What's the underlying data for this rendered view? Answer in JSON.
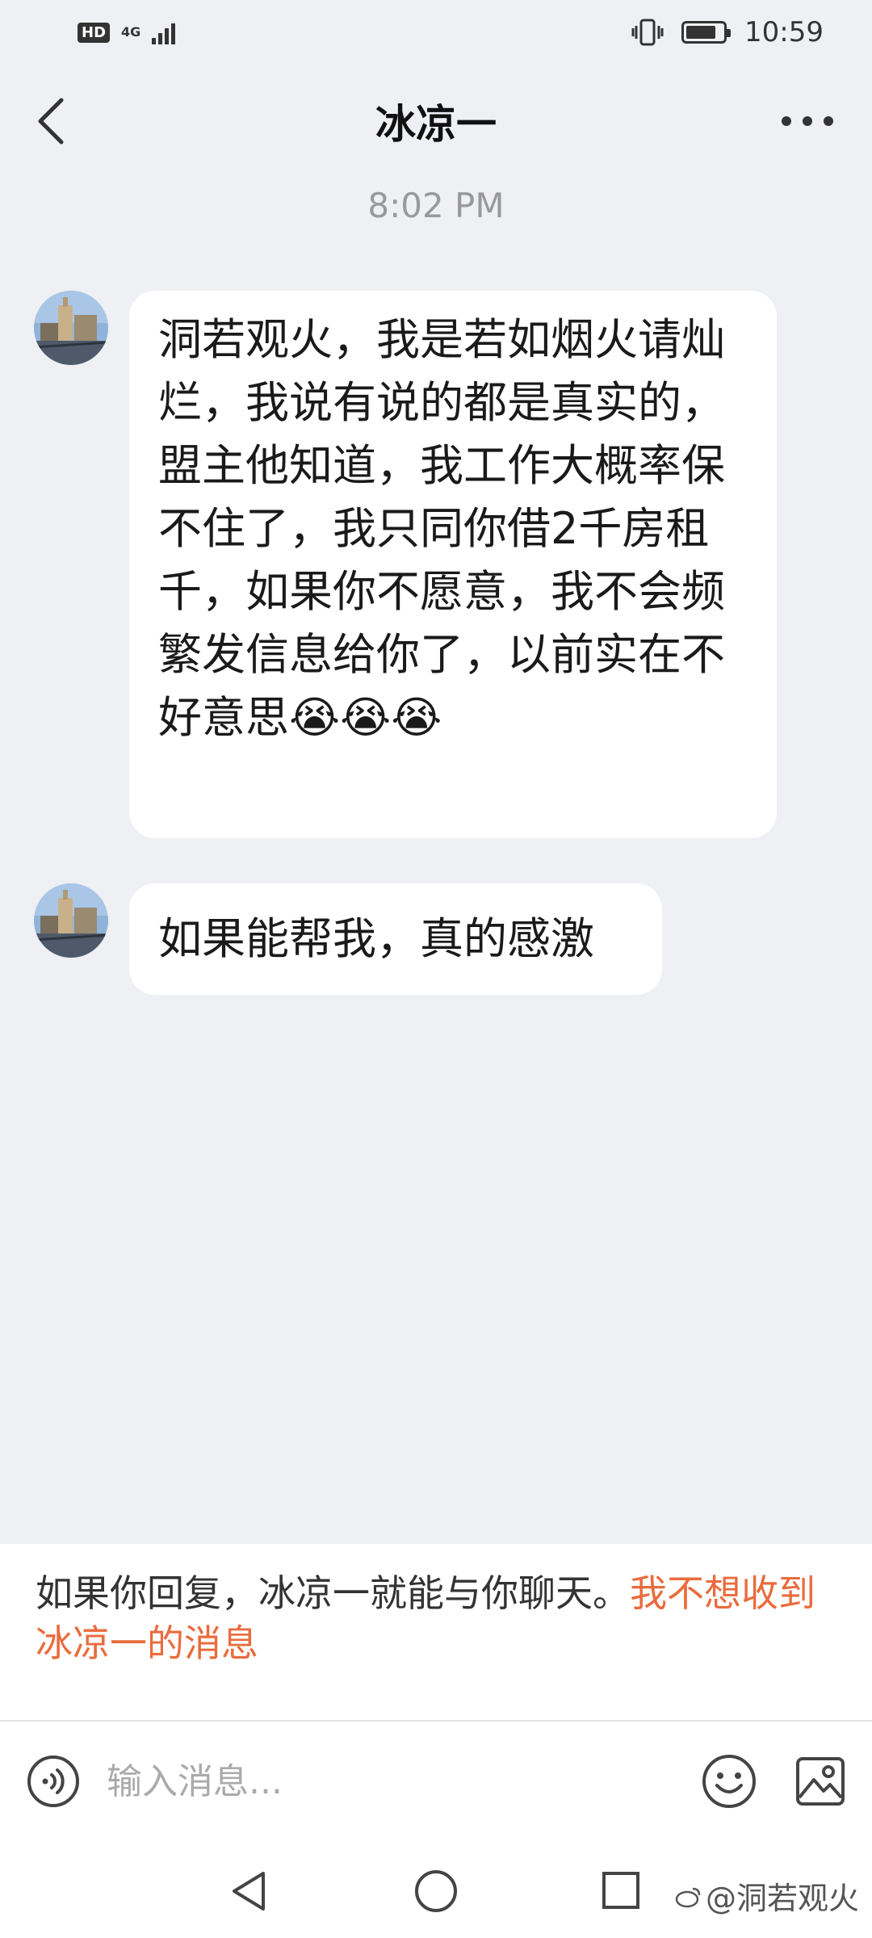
{
  "status_bar": {
    "hd_label": "HD",
    "network_label": "4G",
    "time": "10:59"
  },
  "header": {
    "title": "冰凉一"
  },
  "time_divider": "8:02 PM",
  "messages": [
    {
      "text": "洞若观火，我是若如烟火请灿烂，我说有说的都是真实的，盟主他知道，我工作大概率保不住了，我只同你借2千房租千，如果你不愿意，我不会频繁发信息给你了，以前实在不好意思😭😭😭"
    },
    {
      "text": "如果能帮我，真的感激"
    }
  ],
  "notice": {
    "text": "如果你回复，冰凉一就能与你聊天。",
    "link": "我不想收到冰凉一的消息"
  },
  "input": {
    "placeholder": "输入消息..."
  },
  "watermark": "@洞若观火",
  "colors": {
    "background": "#eff0f3",
    "bubble": "#ffffff",
    "link": "#ea6b3c"
  }
}
